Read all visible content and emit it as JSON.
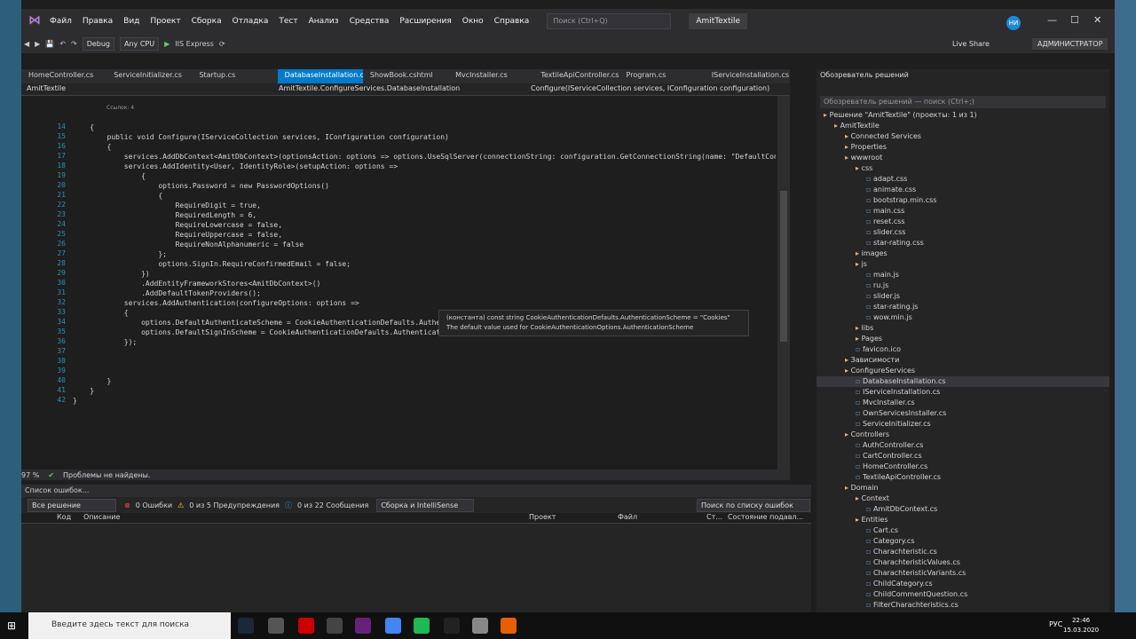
{
  "title_bar": {
    "menu": [
      "Файл",
      "Правка",
      "Вид",
      "Проект",
      "Сборка",
      "Отладка",
      "Тест",
      "Анализ",
      "Средства",
      "Расширения",
      "Окно",
      "Справка"
    ],
    "search_placeholder": "Поиск (Ctrl+Q)",
    "app_title": "AmitTextile",
    "avatar": "НИ",
    "live_share": "Live Share",
    "admin": "АДМИНИСТРАТОР"
  },
  "toolbar": {
    "config": "Debug",
    "platform": "Any CPU",
    "run": "IIS Express"
  },
  "tabs": [
    "HomeController.cs",
    "ServiceInitializer.cs",
    "Startup.cs",
    "DatabaseInstallation.cs",
    "ShowBook.cshtml",
    "MvcInstaller.cs",
    "TextileApiController.cs",
    "Program.cs",
    "IServiceInstallation.cs"
  ],
  "nav": {
    "project": "AmitTextile",
    "type": "AmitTextile.ConfigureServices.DatabaseInstallation",
    "member": "Configure(IServiceCollection services, IConfiguration configuration)"
  },
  "code": {
    "refs": "Ссылок: 4",
    "lines": [
      {
        "n": "14",
        "t": "    {"
      },
      {
        "n": "15",
        "t": "        public void Configure(IServiceCollection services, IConfiguration configuration)"
      },
      {
        "n": "16",
        "t": "        {"
      },
      {
        "n": "17",
        "t": "            services.AddDbContext<AmitDbContext>(optionsAction: options => options.UseSqlServer(connectionString: configuration.GetConnectionString(name: \"DefaultConnection\").Replace("
      },
      {
        "n": "18",
        "t": "            services.AddIdentity<User, IdentityRole>(setupAction: options =>"
      },
      {
        "n": "19",
        "t": "                {"
      },
      {
        "n": "20",
        "t": "                    options.Password = new PasswordOptions()"
      },
      {
        "n": "21",
        "t": "                    {"
      },
      {
        "n": "22",
        "t": "                        RequireDigit = true,"
      },
      {
        "n": "23",
        "t": "                        RequiredLength = 6,"
      },
      {
        "n": "24",
        "t": "                        RequireLowercase = false,"
      },
      {
        "n": "25",
        "t": "                        RequireUppercase = false,"
      },
      {
        "n": "26",
        "t": "                        RequireNonAlphanumeric = false"
      },
      {
        "n": "27",
        "t": "                    };"
      },
      {
        "n": "28",
        "t": "                    options.SignIn.RequireConfirmedEmail = false;"
      },
      {
        "n": "29",
        "t": "                })"
      },
      {
        "n": "30",
        "t": "                .AddEntityFrameworkStores<AmitDbContext>()"
      },
      {
        "n": "31",
        "t": "                .AddDefaultTokenProviders();"
      },
      {
        "n": "32",
        "t": "            services.AddAuthentication(configureOptions: options =>"
      },
      {
        "n": "33",
        "t": "            {"
      },
      {
        "n": "34",
        "t": "                options.DefaultAuthenticateScheme = CookieAuthenticationDefaults.AuthenticationScheme;"
      },
      {
        "n": "35",
        "t": "                options.DefaultSignInScheme = CookieAuthenticationDefaults.Authentication"
      },
      {
        "n": "36",
        "t": "            });"
      },
      {
        "n": "37",
        "t": ""
      },
      {
        "n": "38",
        "t": ""
      },
      {
        "n": "39",
        "t": ""
      },
      {
        "n": "40",
        "t": "        }"
      },
      {
        "n": "41",
        "t": "    }"
      },
      {
        "n": "42",
        "t": "}"
      }
    ]
  },
  "tooltip": {
    "line1": "(константа) const string CookieAuthenticationDefaults.AuthenticationScheme = \"Cookies\"",
    "line2": "The default value used for CookieAuthenticationOptions.AuthenticationScheme"
  },
  "status": {
    "zoom": "97 %",
    "problems": "Проблемы не найдены."
  },
  "errors": {
    "title": "Список ошибок...",
    "scope": "Все решение",
    "err": "0 Ошибки",
    "warn": "0 из 5 Предупреждения",
    "msg": "0 из 22 Сообщения",
    "build": "Сборка и IntelliSense",
    "search": "Поиск по списку ошибок",
    "cols": [
      "Код",
      "Описание",
      "Проект",
      "Файл",
      "Ст...",
      "Состояние подавл..."
    ]
  },
  "explorer": {
    "title": "Обозреватель решений",
    "search": "Обозреватель решений — поиск (Ctrl+;)",
    "items": [
      {
        "d": 0,
        "t": "Решение \"AmitTextile\" (проекты: 1 из 1)"
      },
      {
        "d": 1,
        "t": "AmitTextile"
      },
      {
        "d": 2,
        "t": "Connected Services"
      },
      {
        "d": 2,
        "t": "Properties"
      },
      {
        "d": 2,
        "t": "wwwroot"
      },
      {
        "d": 3,
        "t": "css"
      },
      {
        "d": 4,
        "t": "adapt.css"
      },
      {
        "d": 4,
        "t": "animate.css"
      },
      {
        "d": 4,
        "t": "bootstrap.min.css"
      },
      {
        "d": 4,
        "t": "main.css"
      },
      {
        "d": 4,
        "t": "reset.css"
      },
      {
        "d": 4,
        "t": "slider.css"
      },
      {
        "d": 4,
        "t": "star-rating.css"
      },
      {
        "d": 3,
        "t": "images"
      },
      {
        "d": 3,
        "t": "js"
      },
      {
        "d": 4,
        "t": "main.js"
      },
      {
        "d": 4,
        "t": "ru.js"
      },
      {
        "d": 4,
        "t": "slider.js"
      },
      {
        "d": 4,
        "t": "star-rating.js"
      },
      {
        "d": 4,
        "t": "wow.min.js"
      },
      {
        "d": 3,
        "t": "libs"
      },
      {
        "d": 3,
        "t": "Pages"
      },
      {
        "d": 3,
        "t": "favicon.ico"
      },
      {
        "d": 2,
        "t": "Зависимости"
      },
      {
        "d": 2,
        "t": "ConfigureServices"
      },
      {
        "d": 3,
        "t": "DatabaseInstallation.cs"
      },
      {
        "d": 3,
        "t": "IServiceInstallation.cs"
      },
      {
        "d": 3,
        "t": "MvcInstaller.cs"
      },
      {
        "d": 3,
        "t": "OwnServicesInstaller.cs"
      },
      {
        "d": 3,
        "t": "ServiceInitializer.cs"
      },
      {
        "d": 2,
        "t": "Controllers"
      },
      {
        "d": 3,
        "t": "AuthController.cs"
      },
      {
        "d": 3,
        "t": "CartController.cs"
      },
      {
        "d": 3,
        "t": "HomeController.cs"
      },
      {
        "d": 3,
        "t": "TextileApiController.cs"
      },
      {
        "d": 2,
        "t": "Domain"
      },
      {
        "d": 3,
        "t": "Context"
      },
      {
        "d": 4,
        "t": "AmitDbContext.cs"
      },
      {
        "d": 3,
        "t": "Entities"
      },
      {
        "d": 4,
        "t": "Cart.cs"
      },
      {
        "d": 4,
        "t": "Category.cs"
      },
      {
        "d": 4,
        "t": "Charachteristic.cs"
      },
      {
        "d": 4,
        "t": "CharachteristicValues.cs"
      },
      {
        "d": 4,
        "t": "CharachteristicVariants.cs"
      },
      {
        "d": 4,
        "t": "ChildCategory.cs"
      },
      {
        "d": 4,
        "t": "ChildCommentQuestion.cs"
      },
      {
        "d": 4,
        "t": "FilterCharachteristics.cs"
      }
    ]
  },
  "taskbar": {
    "search": "Введите здесь текст для поиска",
    "lang": "РУС",
    "time": "22:46",
    "date": "15.03.2020"
  }
}
